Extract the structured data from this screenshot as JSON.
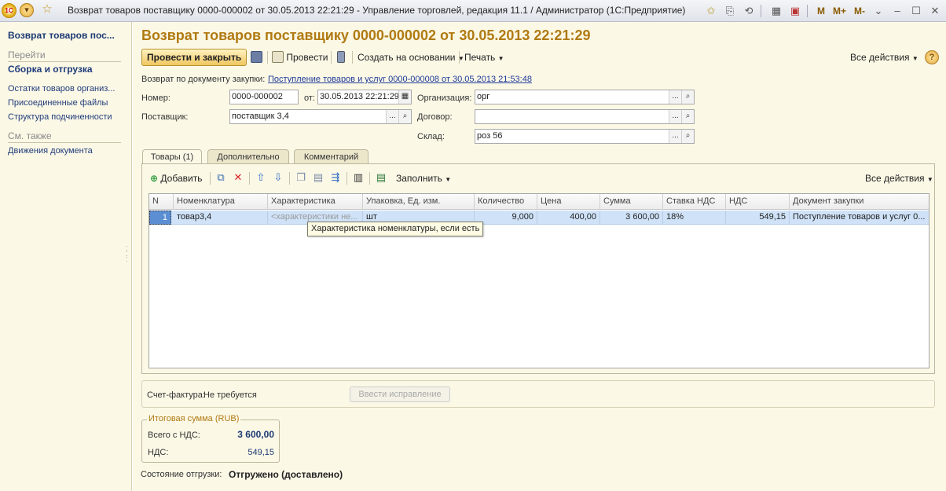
{
  "window": {
    "title": "Возврат товаров поставщику 0000-000002 от 30.05.2013 22:21:29 - Управление торговлей, редакция 11.1 / Администратор  (1С:Предприятие)",
    "logo_text": "1С",
    "m_labels": [
      "M",
      "M+",
      "M-"
    ]
  },
  "sidebar": {
    "title": "Возврат товаров пос...",
    "goto_header": "Перейти",
    "goto_items": [
      "Сборка и отгрузка",
      "Остатки товаров организ...",
      "Присоединенные файлы",
      "Структура подчиненности"
    ],
    "see_also_header": "См. также",
    "see_also_items": [
      "Движения документа"
    ]
  },
  "document": {
    "title": "Возврат товаров поставщику 0000-000002 от 30.05.2013 22:21:29"
  },
  "toolbar": {
    "post_close": "Провести и закрыть",
    "post": "Провести",
    "create_based": "Создать на основании",
    "print": "Печать",
    "all_actions": "Все действия",
    "help": "?"
  },
  "form": {
    "purchase_doc_label": "Возврат по документу закупки:",
    "purchase_doc_link": "Поступление товаров и услуг 0000-000008 от 30.05.2013 21:53:48",
    "number_label": "Номер:",
    "number_value": "0000-000002",
    "date_label": "от:",
    "date_value": "30.05.2013 22:21:29",
    "org_label": "Организация:",
    "org_value": "орг",
    "supplier_label": "Поставщик:",
    "supplier_value": "поставщик 3,4",
    "contract_label": "Договор:",
    "contract_value": "",
    "warehouse_label": "Склад:",
    "warehouse_value": "роз 56",
    "dots": "..."
  },
  "tabs": [
    "Товары (1)",
    "Дополнительно",
    "Комментарий"
  ],
  "table_toolbar": {
    "add": "Добавить",
    "fill": "Заполнить",
    "all_actions": "Все действия"
  },
  "table": {
    "columns": [
      "N",
      "Номенклатура",
      "Характеристика",
      "Упаковка, Ед. изм.",
      "Количество",
      "Цена",
      "Сумма",
      "Ставка НДС",
      "НДС",
      "Документ закупки"
    ],
    "rows": [
      [
        "1",
        "товар3,4",
        "<характеристики не...",
        "шт",
        "9,000",
        "400,00",
        "3 600,00",
        "18%",
        "549,15",
        "Поступление товаров и услуг 0..."
      ]
    ]
  },
  "tooltip": "Характеристика номенклатуры, если есть",
  "invoice": {
    "label": "Счет-фактура:",
    "value": "Не требуется",
    "correction_button": "Ввести исправление"
  },
  "totals": {
    "legend": "Итоговая сумма (RUB)",
    "total_label": "Всего с НДС:",
    "total_value": "3 600,00",
    "vat_label": "НДС:",
    "vat_value": "549,15"
  },
  "shipment": {
    "label": "Состояние отгрузки:",
    "value": "Отгружено (доставлено)"
  }
}
